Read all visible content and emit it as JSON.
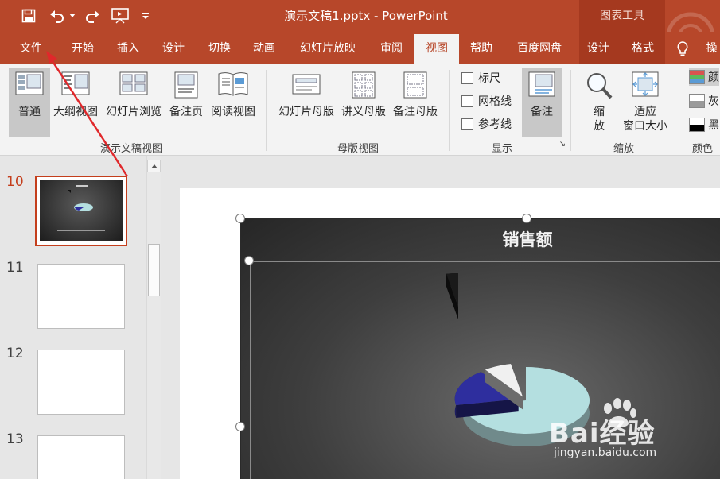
{
  "window": {
    "title": "演示文稿1.pptx - PowerPoint",
    "context_tools": "图表工具"
  },
  "quick_access": [
    {
      "icon": "save-icon"
    },
    {
      "icon": "undo-icon"
    },
    {
      "icon": "redo-icon"
    },
    {
      "icon": "present-icon"
    },
    {
      "icon": "customize-icon"
    }
  ],
  "tabs": [
    {
      "label": "文件",
      "active": false
    },
    {
      "label": "开始",
      "active": false
    },
    {
      "label": "插入",
      "active": false
    },
    {
      "label": "设计",
      "active": false
    },
    {
      "label": "切换",
      "active": false
    },
    {
      "label": "动画",
      "active": false
    },
    {
      "label": "幻灯片放映",
      "active": false
    },
    {
      "label": "审阅",
      "active": false
    },
    {
      "label": "视图",
      "active": true
    },
    {
      "label": "帮助",
      "active": false
    },
    {
      "label": "百度网盘",
      "active": false
    },
    {
      "label": "设计",
      "active": false
    },
    {
      "label": "格式",
      "active": false
    },
    {
      "label": "操",
      "active": false
    }
  ],
  "ribbon": {
    "presentation_views": {
      "group_label": "演示文稿视图",
      "buttons": [
        "普通",
        "大纲视图",
        "幻灯片浏览",
        "备注页",
        "阅读视图"
      ]
    },
    "master_views": {
      "group_label": "母版视图",
      "buttons": [
        "幻灯片母版",
        "讲义母版",
        "备注母版"
      ]
    },
    "show": {
      "group_label": "显示",
      "checkboxes": [
        "标尺",
        "网格线",
        "参考线"
      ],
      "notes_button": "备注"
    },
    "zoom": {
      "group_label": "缩放",
      "zoom_line1": "缩",
      "zoom_line2": "放",
      "fit_line1": "适应",
      "fit_line2": "窗口大小"
    },
    "color": {
      "group_label": "颜色",
      "options": [
        "颜",
        "灰",
        "黑"
      ],
      "swatch_colors": [
        "#d9534f",
        "#9a9a9a",
        "#000000"
      ]
    }
  },
  "slides": [
    {
      "number": "10",
      "current": true
    },
    {
      "number": "11",
      "current": false
    },
    {
      "number": "12",
      "current": false
    },
    {
      "number": "13",
      "current": false
    }
  ],
  "slide_content": {
    "chart_title": "销售额"
  },
  "chart_data": {
    "type": "pie",
    "title": "销售额",
    "style": "3d-exploded",
    "series": [
      {
        "values": [
          72,
          18,
          7,
          3
        ]
      }
    ],
    "slice_colors": [
      "#b4dfe0",
      "#2e2e9e",
      "#f0f0f0",
      "#1a1a1a"
    ]
  },
  "watermark": {
    "brand": "Bai经验",
    "url": "jingyan.baidu.com"
  },
  "colors": {
    "accent": "#b7472a",
    "selection": "#c43e1c",
    "arrow": "#e0282b"
  }
}
